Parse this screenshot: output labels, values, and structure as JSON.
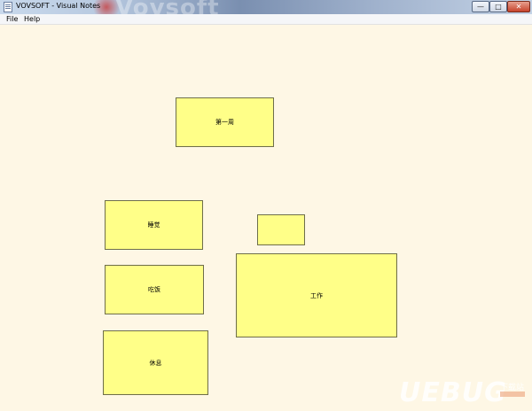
{
  "window": {
    "title": "VOVSOFT - Visual Notes",
    "brand_watermark": "Vovsoft",
    "controls": {
      "minimize": "—",
      "maximize": "□",
      "close": "✕"
    }
  },
  "menu": {
    "file": "File",
    "help": "Help"
  },
  "notes": [
    {
      "id": "week",
      "text": "第一周"
    },
    {
      "id": "sleep",
      "text": "睡觉"
    },
    {
      "id": "blank",
      "text": ""
    },
    {
      "id": "eat",
      "text": "吃饭"
    },
    {
      "id": "work",
      "text": "工作"
    },
    {
      "id": "rest",
      "text": "休息"
    }
  ],
  "overlay": {
    "watermark": "UEBUG",
    "watermark_sub": "下载站"
  },
  "colors": {
    "note_fill": "#ffff88",
    "canvas_bg": "#fef7e5"
  }
}
